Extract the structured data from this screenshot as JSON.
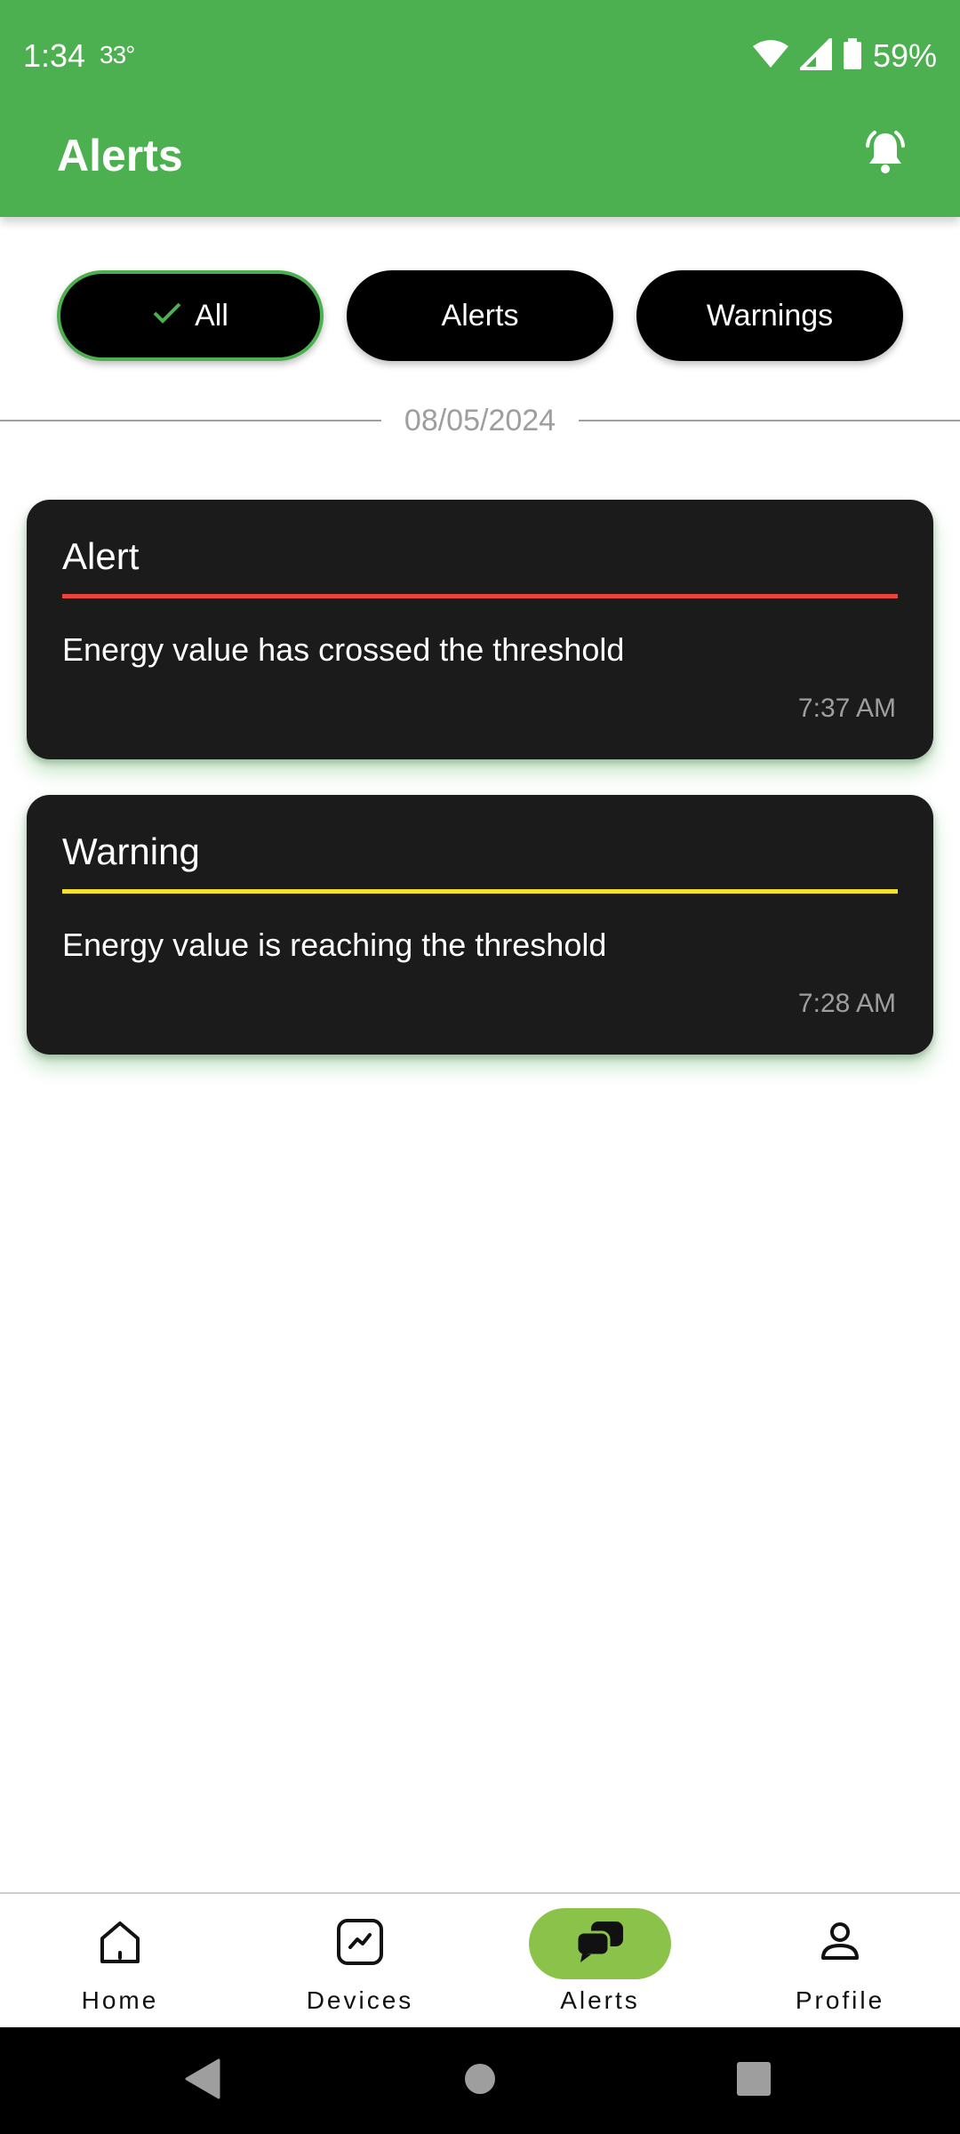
{
  "status_bar": {
    "time": "1:34",
    "temperature": "33°",
    "battery": "59%",
    "icons": [
      "wifi-icon",
      "cellular-signal-icon",
      "battery-icon"
    ]
  },
  "app_bar": {
    "title": "Alerts",
    "action_icon": "bell-icon"
  },
  "filters": {
    "chips": [
      {
        "label": "All",
        "selected": true
      },
      {
        "label": "Alerts",
        "selected": false
      },
      {
        "label": "Warnings",
        "selected": false
      }
    ]
  },
  "date_header": "08/05/2024",
  "notifications": [
    {
      "type": "Alert",
      "message": "Energy value has crossed the threshold",
      "time": "7:37 AM",
      "accent_color": "#e8453c"
    },
    {
      "type": "Warning",
      "message": "Energy value is reaching the threshold",
      "time": "7:28 AM",
      "accent_color": "#f2e12c"
    }
  ],
  "bottom_nav": {
    "items": [
      {
        "label": "Home",
        "icon": "home-icon"
      },
      {
        "label": "Devices",
        "icon": "chart-icon"
      },
      {
        "label": "Alerts",
        "icon": "chat-bubbles-icon",
        "active": true
      },
      {
        "label": "Profile",
        "icon": "person-icon"
      }
    ]
  },
  "colors": {
    "primary": "#4caf50",
    "active_nav": "#8bc34a",
    "card_background": "#1a1b1a"
  }
}
